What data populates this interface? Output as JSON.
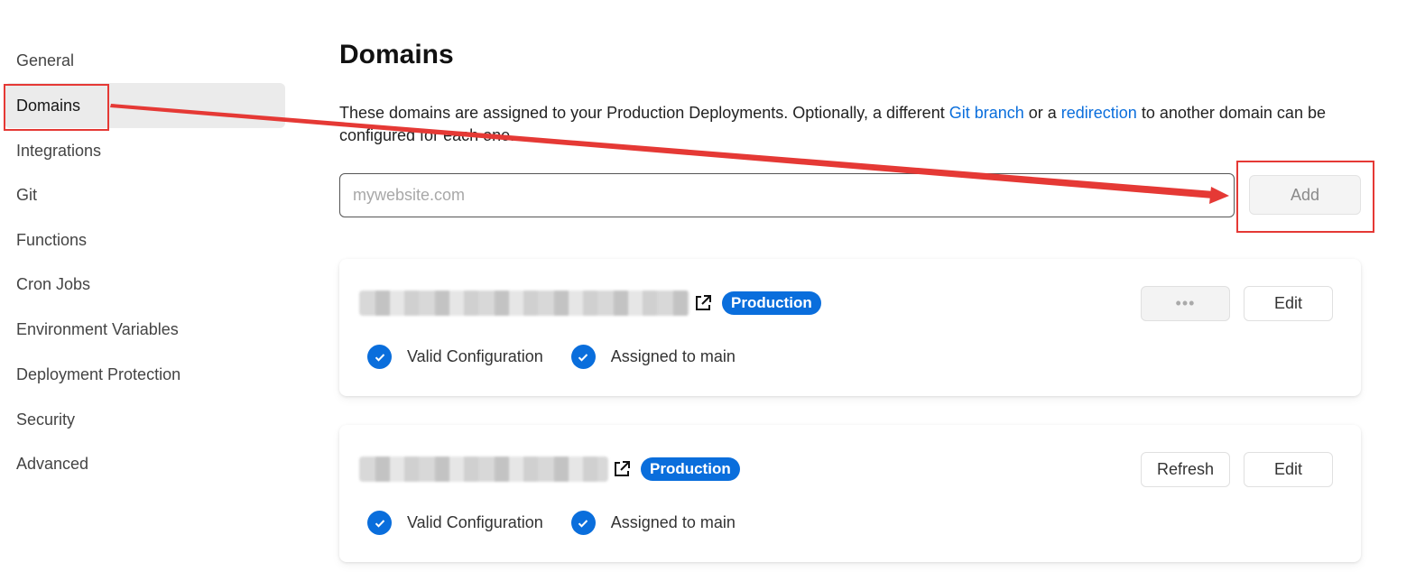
{
  "sidebar": {
    "items": [
      {
        "label": "General",
        "active": false
      },
      {
        "label": "Domains",
        "active": true
      },
      {
        "label": "Integrations",
        "active": false
      },
      {
        "label": "Git",
        "active": false
      },
      {
        "label": "Functions",
        "active": false
      },
      {
        "label": "Cron Jobs",
        "active": false
      },
      {
        "label": "Environment Variables",
        "active": false
      },
      {
        "label": "Deployment Protection",
        "active": false
      },
      {
        "label": "Security",
        "active": false
      },
      {
        "label": "Advanced",
        "active": false
      }
    ]
  },
  "main": {
    "title": "Domains",
    "description_pre": "These domains are assigned to your Production Deployments. Optionally, a different ",
    "link_git_branch": "Git branch",
    "description_mid": " or a ",
    "link_redirection": "redirection",
    "description_post": " to another domain can be configured for each one.",
    "input_placeholder": "mywebsite.com",
    "input_value": "",
    "add_label": "Add"
  },
  "domains": [
    {
      "badge": "Production",
      "status_1": "Valid Configuration",
      "status_2": "Assigned to main",
      "more_label": "•••",
      "edit_label": "Edit"
    },
    {
      "badge": "Production",
      "status_1": "Valid Configuration",
      "status_2": "Assigned to main",
      "refresh_label": "Refresh",
      "edit_label": "Edit"
    }
  ],
  "colors": {
    "accent": "#0a6edc",
    "annotation": "#e53935",
    "active_bg": "#ebebeb"
  }
}
